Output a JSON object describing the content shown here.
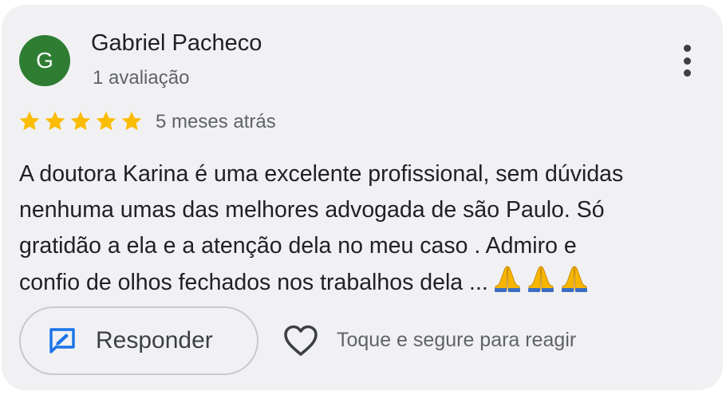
{
  "reviewer": {
    "avatar_initial": "G",
    "avatar_color": "#2e7d32",
    "name": "Gabriel Pacheco",
    "review_count": "1 avaliação"
  },
  "review": {
    "rating": 5,
    "max_rating": 5,
    "star_color": "#fbbc04",
    "date": "5 meses atrás",
    "text_lines": [
      "A doutora Karina é uma excelente profissional, sem dúvidas",
      "nenhuma umas das melhores advogada de são Paulo. Só",
      "gratidão a ela e a atenção dela no meu caso . Admiro e",
      "confio de olhos fechados nos trabalhos dela ..."
    ],
    "emoji": "🙏🙏🙏"
  },
  "actions": {
    "reply_label": "Responder",
    "react_hint": "Toque e segure para reagir",
    "more_icon": "more-vert-icon",
    "reply_icon": "edit-reply-icon",
    "react_icon": "heart-outline-icon",
    "accent_color": "#1a73e8"
  }
}
